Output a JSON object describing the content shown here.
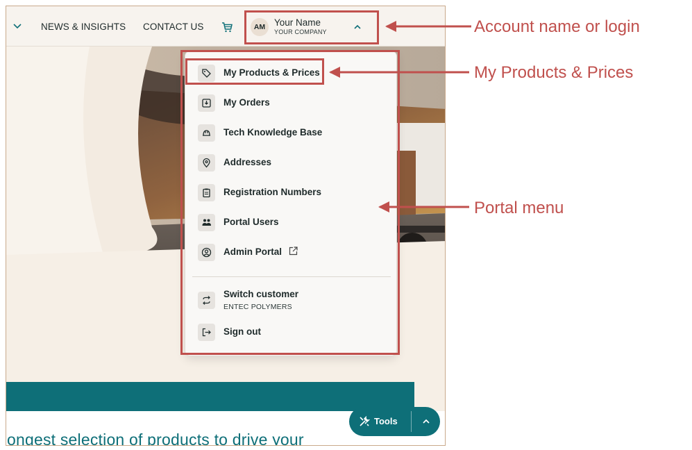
{
  "nav": {
    "news_label": "NEWS & INSIGHTS",
    "contact_label": "CONTACT US"
  },
  "account": {
    "initials": "AM",
    "name": "Your Name",
    "company": "YOUR COMPANY"
  },
  "menu": {
    "items": [
      {
        "label": "My Products & Prices",
        "icon": "tag-icon"
      },
      {
        "label": "My Orders",
        "icon": "package-icon"
      },
      {
        "label": "Tech Knowledge Base",
        "icon": "hard-hat-icon"
      },
      {
        "label": "Addresses",
        "icon": "map-pin-icon"
      },
      {
        "label": "Registration Numbers",
        "icon": "clipboard-icon"
      },
      {
        "label": "Portal Users",
        "icon": "users-icon"
      },
      {
        "label": "Admin Portal",
        "icon": "user-circle-icon"
      }
    ],
    "switch_customer": {
      "label": "Switch customer",
      "sub": "ENTEC POLYMERS",
      "icon": "switch-arrows-icon"
    },
    "sign_out": {
      "label": "Sign out",
      "icon": "sign-out-icon"
    }
  },
  "hero": {
    "tagline": "ongest selection of products to drive your"
  },
  "tools": {
    "label": "Tools"
  },
  "annotations": {
    "account": "Account name or login",
    "products": "My Products & Prices",
    "portal": "Portal menu"
  },
  "colors": {
    "accent": "#0e6f78",
    "annotation": "#c0504d",
    "page_bg": "#f6efe6"
  }
}
